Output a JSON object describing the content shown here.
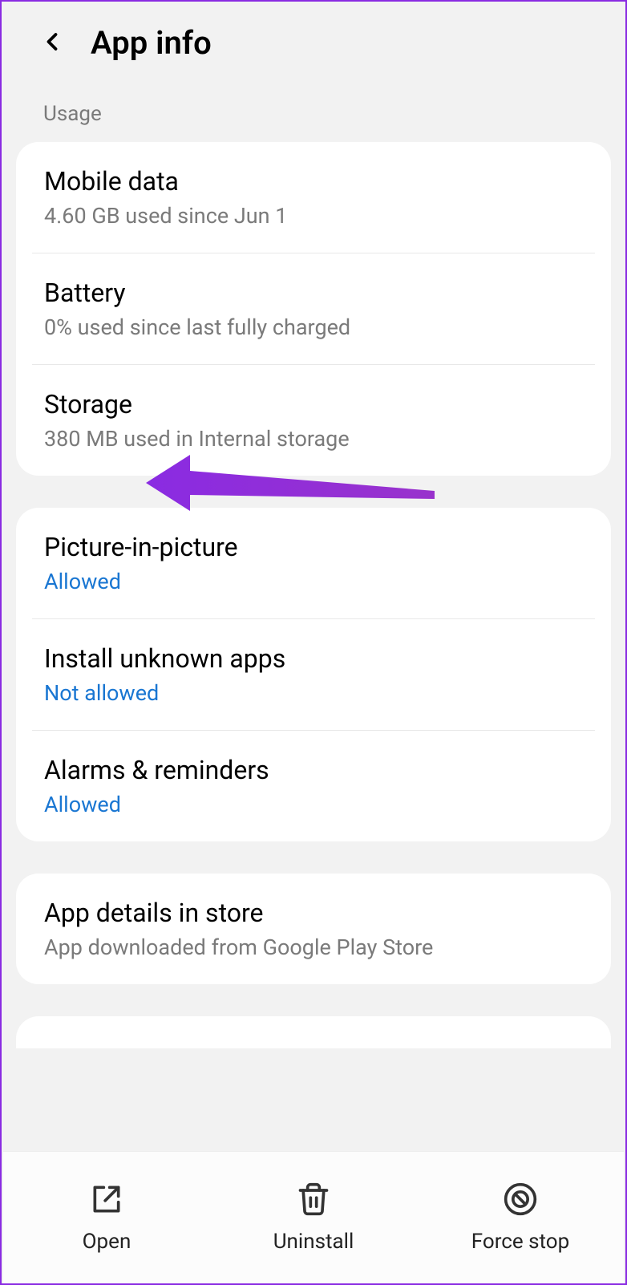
{
  "header": {
    "title": "App info"
  },
  "usage": {
    "label": "Usage",
    "mobile_data": {
      "title": "Mobile data",
      "subtitle": "4.60 GB used since Jun 1"
    },
    "battery": {
      "title": "Battery",
      "subtitle": "0% used since last fully charged"
    },
    "storage": {
      "title": "Storage",
      "subtitle": "380 MB used in Internal storage"
    }
  },
  "permissions": {
    "pip": {
      "title": "Picture-in-picture",
      "status": "Allowed"
    },
    "unknown": {
      "title": "Install unknown apps",
      "status": "Not allowed"
    },
    "alarms": {
      "title": "Alarms & reminders",
      "status": "Allowed"
    }
  },
  "store": {
    "title": "App details in store",
    "subtitle": "App downloaded from Google Play Store"
  },
  "bottom": {
    "open": "Open",
    "uninstall": "Uninstall",
    "force_stop": "Force stop"
  },
  "annotation": {
    "color": "#8a2be2"
  }
}
